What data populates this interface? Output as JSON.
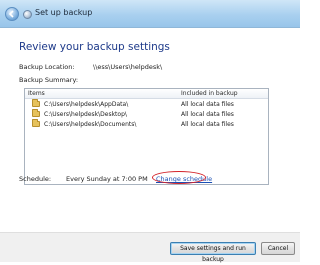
{
  "window": {
    "title": "Set up backup"
  },
  "heading": "Review your backup settings",
  "backup_location": {
    "label": "Backup Location:",
    "value": "\\\\ess\\Users\\helpdesk\\"
  },
  "backup_summary": {
    "label": "Backup Summary:",
    "columns": [
      "Items",
      "Included in backup"
    ],
    "rows": [
      {
        "item": "C:\\Users\\helpdesk\\AppData\\",
        "included": "All local data files"
      },
      {
        "item": "C:\\Users\\helpdesk\\Desktop\\",
        "included": "All local data files"
      },
      {
        "item": "C:\\Users\\helpdesk\\Documents\\",
        "included": "All local data files"
      }
    ]
  },
  "schedule": {
    "label": "Schedule:",
    "value": "Every Sunday at 7:00 PM",
    "change_link": "Change schedule"
  },
  "footer": {
    "primary_button": "Save settings and run backup",
    "cancel_button": "Cancel"
  },
  "colors": {
    "heading": "#1e3a8a",
    "link": "#1a4fb5",
    "highlight_circle": "#d3232a"
  }
}
